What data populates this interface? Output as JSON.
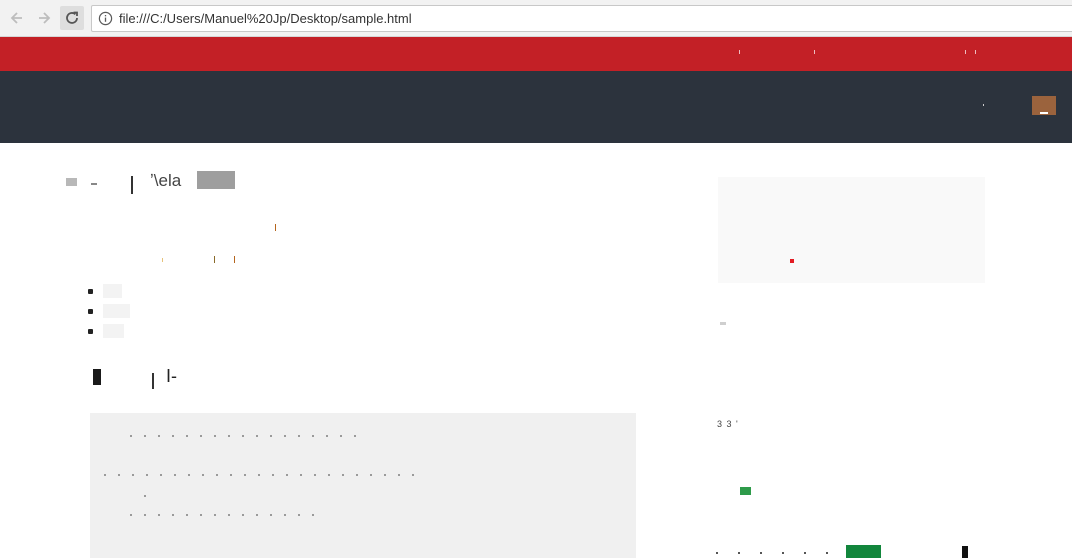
{
  "browser": {
    "url": "file:///C:/Users/Manuel%20Jp/Desktop/sample.html",
    "back_icon": "arrow-left-icon",
    "forward_icon": "arrow-right-icon",
    "reload_icon": "reload-icon",
    "info_icon": "info-circle-icon"
  },
  "colors": {
    "topbar": "#c32026",
    "navbar": "#2c333d",
    "avatar": "#9b633d",
    "code_background": "#f0f0f0",
    "side_panel": "#f9f9f9",
    "accent_green": "#2e9b4a"
  },
  "content": {
    "heading_fragment": "ʼ\\ela",
    "subheading_fragment": "I-",
    "bullet_count": 3
  },
  "sidebar": {
    "fragment": "3 3 '"
  }
}
